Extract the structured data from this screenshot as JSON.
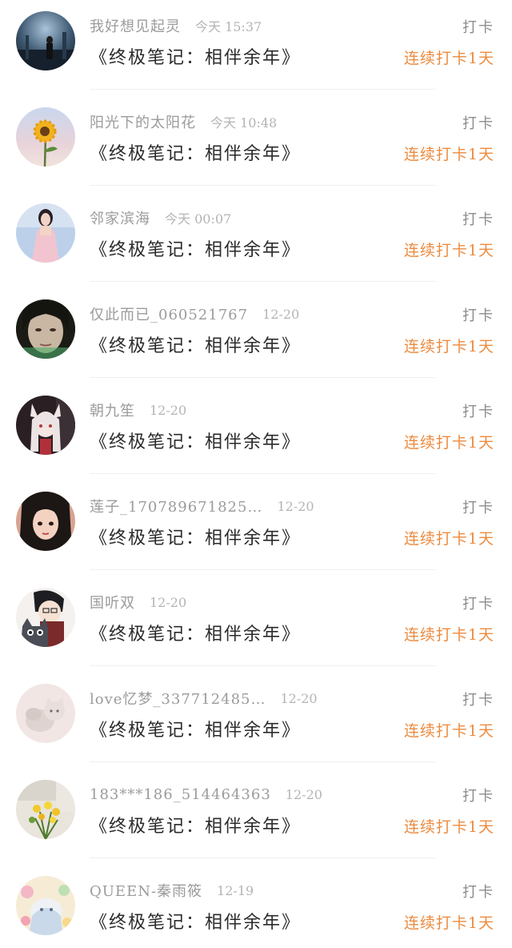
{
  "rows": [
    {
      "username": "我好想见起灵",
      "time": "今天 15:37",
      "book": "《终极笔记：相伴余年》",
      "checkin": "打卡",
      "streak": "连续打卡1天",
      "avatar_icon": "night-figure-avatar-icon"
    },
    {
      "username": "阳光下的太阳花",
      "time": "今天 10:48",
      "book": "《终极笔记：相伴余年》",
      "checkin": "打卡",
      "streak": "连续打卡1天",
      "avatar_icon": "sunflower-avatar-icon"
    },
    {
      "username": "邻家滨海",
      "time": "今天 00:07",
      "book": "《终极笔记：相伴余年》",
      "checkin": "打卡",
      "streak": "连续打卡1天",
      "avatar_icon": "girl-photo-avatar-icon"
    },
    {
      "username": "仅此而已_060521767",
      "time": "12-20",
      "book": "《终极笔记：相伴余年》",
      "checkin": "打卡",
      "streak": "连续打卡1天",
      "avatar_icon": "face-closeup-avatar-icon"
    },
    {
      "username": "朝九笙",
      "time": "12-20",
      "book": "《终极笔记：相伴余年》",
      "checkin": "打卡",
      "streak": "连续打卡1天",
      "avatar_icon": "anime-fox-girl-avatar-icon"
    },
    {
      "username": "莲子_170789671825…",
      "time": "12-20",
      "book": "《终极笔记：相伴余年》",
      "checkin": "打卡",
      "streak": "连续打卡1天",
      "avatar_icon": "drawn-girl-avatar-icon"
    },
    {
      "username": "国听双",
      "time": "12-20",
      "book": "《终极笔记：相伴余年》",
      "checkin": "打卡",
      "streak": "连续打卡1天",
      "avatar_icon": "anime-boy-cat-avatar-icon"
    },
    {
      "username": "love忆梦_337712485…",
      "time": "12-20",
      "book": "《终极笔记：相伴余年》",
      "checkin": "打卡",
      "streak": "连续打卡1天",
      "avatar_icon": "kitten-avatar-icon"
    },
    {
      "username": "183***186_514464363",
      "time": "12-20",
      "book": "《终极笔记：相伴余年》",
      "checkin": "打卡",
      "streak": "连续打卡1天",
      "avatar_icon": "flowers-avatar-icon"
    },
    {
      "username": "QUEEN-秦雨筱",
      "time": "12-19",
      "book": "《终极笔记：相伴余年》",
      "checkin": "打卡",
      "streak": "连续打卡1天",
      "avatar_icon": "pastel-illustration-avatar-icon"
    }
  ],
  "colors": {
    "username": "#9b9b9b",
    "time": "#b4b4b4",
    "book": "#2a2a2a",
    "checkin": "#8c8c8c",
    "streak": "#ec8b3f"
  }
}
